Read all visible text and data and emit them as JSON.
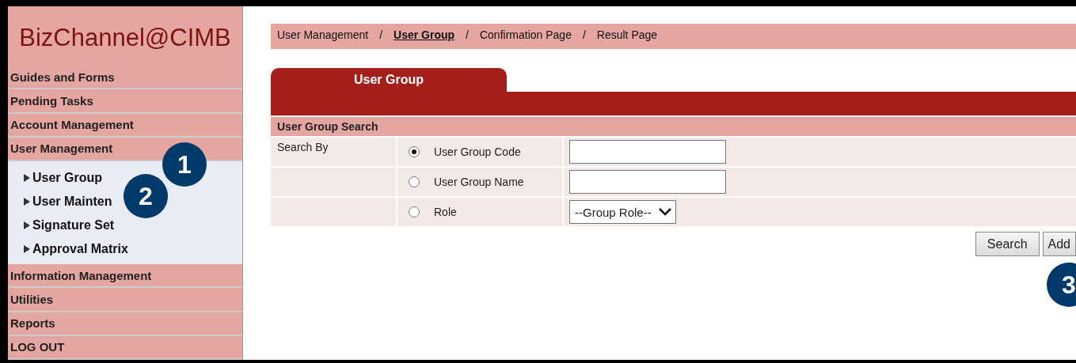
{
  "logo": "BizChannel@CIMB",
  "sidebar": {
    "items": [
      {
        "label": "Guides and Forms"
      },
      {
        "label": "Pending Tasks"
      },
      {
        "label": "Account Management"
      },
      {
        "label": "User Management",
        "children": [
          {
            "label": "User Group"
          },
          {
            "label": "User Mainten"
          },
          {
            "label": "Signature Set"
          },
          {
            "label": "Approval Matrix"
          }
        ]
      },
      {
        "label": "Information Management"
      },
      {
        "label": "Utilities"
      },
      {
        "label": "Reports"
      },
      {
        "label": "LOG OUT"
      }
    ]
  },
  "breadcrumb": [
    {
      "label": "User Management",
      "selected": false
    },
    {
      "label": "User Group",
      "selected": true
    },
    {
      "label": "Confirmation Page",
      "selected": false
    },
    {
      "label": "Result Page",
      "selected": false
    }
  ],
  "breadcrumb_separator": "/",
  "tab": {
    "label": "User Group"
  },
  "search_panel": {
    "title": "User Group Search",
    "label": "Search By",
    "options": [
      {
        "label": "User Group Code",
        "selected": true,
        "kind": "text"
      },
      {
        "label": "User Group Name",
        "selected": false,
        "kind": "text"
      },
      {
        "label": "Role",
        "selected": false,
        "kind": "select",
        "value": "--Group Role--"
      }
    ]
  },
  "buttons": [
    "Search",
    "Add"
  ],
  "callouts": [
    {
      "number": "1",
      "kind": "menu"
    },
    {
      "number": "2",
      "kind": "submenu"
    },
    {
      "number": "3",
      "kind": "button"
    }
  ]
}
